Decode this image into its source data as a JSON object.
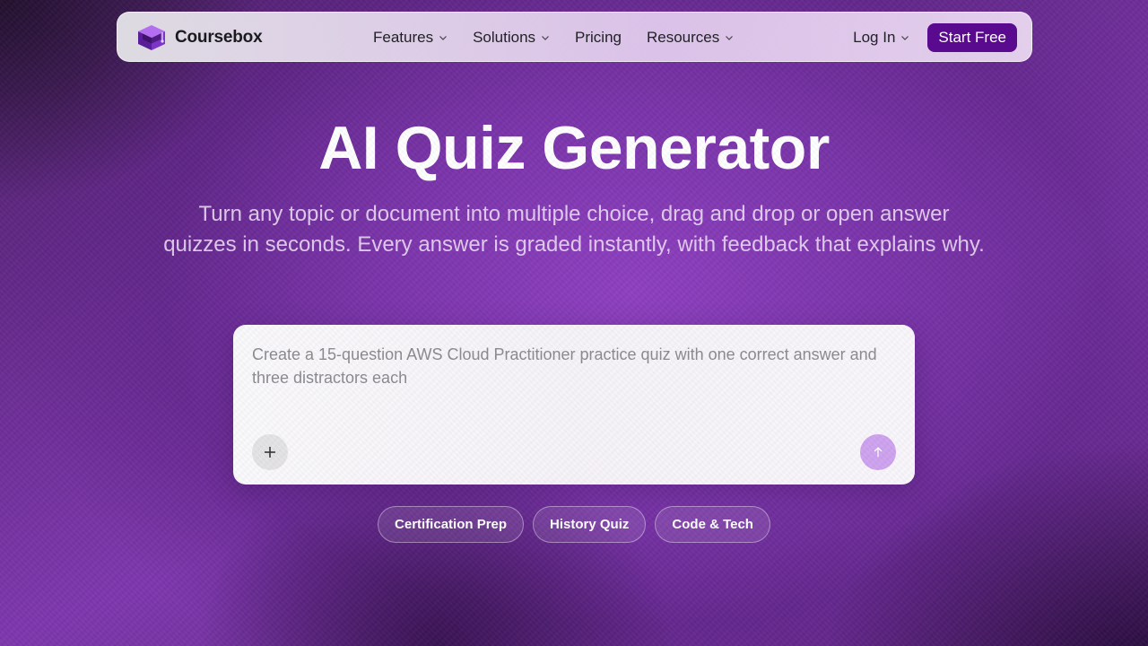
{
  "brand": {
    "name": "Coursebox",
    "logo_icon": "graduation-cap-cube-icon"
  },
  "nav": {
    "items": [
      {
        "label": "Features",
        "has_dropdown": true
      },
      {
        "label": "Solutions",
        "has_dropdown": true
      },
      {
        "label": "Pricing",
        "has_dropdown": false
      },
      {
        "label": "Resources",
        "has_dropdown": true
      }
    ],
    "login_label": "Log In",
    "start_label": "Start Free"
  },
  "hero": {
    "title": "AI Quiz Generator",
    "subtitle": "Turn any topic or document into multiple choice, drag and drop or open answer quizzes in seconds. Every answer is graded instantly, with feedback that explains why."
  },
  "prompt": {
    "placeholder": "Create a 15-question AWS Cloud Practitioner practice quiz with one correct answer and three distractors each",
    "value": "",
    "add_icon": "plus-icon",
    "send_icon": "arrow-up-icon"
  },
  "chips": [
    {
      "label": "Certification Prep"
    },
    {
      "label": "History Quiz"
    },
    {
      "label": "Code & Tech"
    }
  ],
  "colors": {
    "accent": "#5a0a8e",
    "send_button": "#cfa3f0",
    "background": "#7a34aa"
  }
}
